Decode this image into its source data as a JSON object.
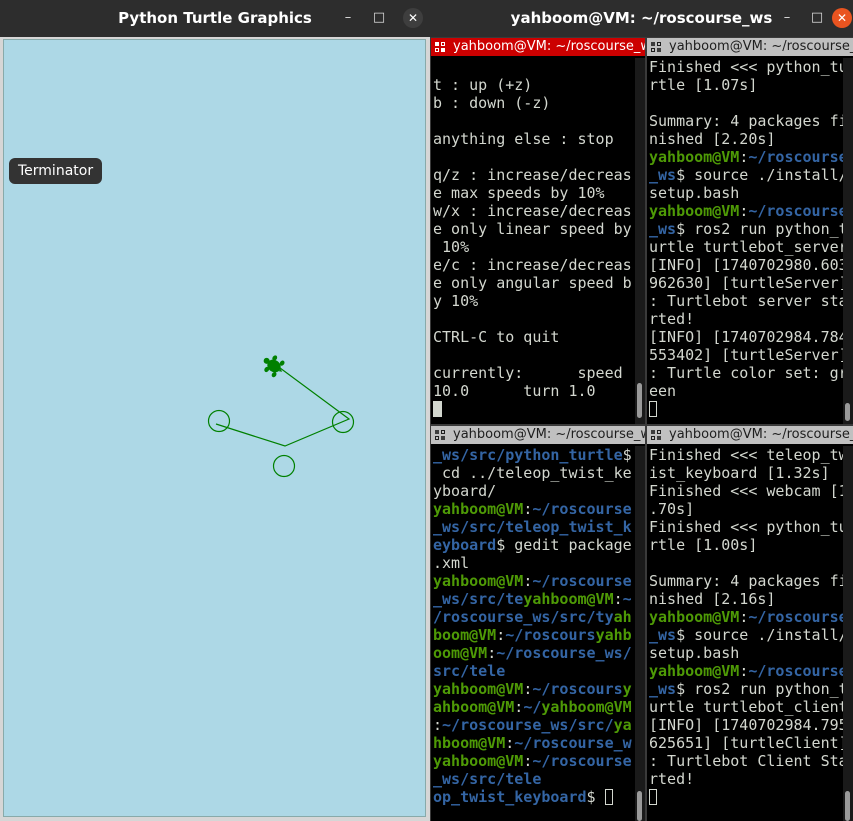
{
  "turtle_window": {
    "title": "Python Turtle Graphics",
    "minimize_icon": "minimize-icon",
    "maximize_icon": "maximize-icon",
    "close_icon": "close-icon",
    "tooltip": "Terminator",
    "canvas_bg": "#add8e6",
    "pen_color": "#008000"
  },
  "terminator": {
    "title": "yahboom@VM: ~/roscourse_ws",
    "panes": [
      {
        "name": "pane-top-left",
        "title": "yahboom@VM: ~/roscourse_ws",
        "active": true,
        "lines": [
          [
            {
              "t": ""
            }
          ],
          [
            {
              "t": "t : up (+z)"
            }
          ],
          [
            {
              "t": "b : down (-z)"
            }
          ],
          [
            {
              "t": ""
            }
          ],
          [
            {
              "t": "anything else : stop"
            }
          ],
          [
            {
              "t": ""
            }
          ],
          [
            {
              "t": "q/z : increase/decreas"
            }
          ],
          [
            {
              "t": "e max speeds by 10%"
            }
          ],
          [
            {
              "t": "w/x : increase/decreas"
            }
          ],
          [
            {
              "t": "e only linear speed by"
            }
          ],
          [
            {
              "t": " 10%"
            }
          ],
          [
            {
              "t": "e/c : increase/decreas"
            }
          ],
          [
            {
              "t": "e only angular speed b"
            }
          ],
          [
            {
              "t": "y 10%"
            }
          ],
          [
            {
              "t": ""
            }
          ],
          [
            {
              "t": "CTRL-C to quit"
            }
          ],
          [
            {
              "t": ""
            }
          ],
          [
            {
              "t": "currently:      speed "
            }
          ],
          [
            {
              "t": "10.0      turn 1.0"
            }
          ]
        ],
        "cursor": "fill"
      },
      {
        "name": "pane-top-right",
        "title": "yahboom@VM: ~/roscourse_ws",
        "active": false,
        "lines": [
          [
            {
              "t": "Finished <<< python_tu"
            }
          ],
          [
            {
              "t": "rtle [1.07s]"
            }
          ],
          [
            {
              "t": ""
            }
          ],
          [
            {
              "t": "Summary: 4 packages fi"
            }
          ],
          [
            {
              "t": "nished [2.20s]"
            }
          ],
          [
            {
              "t": "yahboom@VM",
              "c": "g"
            },
            {
              "t": ":",
              "c": ""
            },
            {
              "t": "~/roscourse",
              "c": "b"
            }
          ],
          [
            {
              "t": "_ws",
              "c": "b"
            },
            {
              "t": "$ source ./install/"
            }
          ],
          [
            {
              "t": "setup.bash"
            }
          ],
          [
            {
              "t": "yahboom@VM",
              "c": "g"
            },
            {
              "t": ":"
            },
            {
              "t": "~/roscourse",
              "c": "b"
            }
          ],
          [
            {
              "t": "_ws",
              "c": "b"
            },
            {
              "t": "$ ros2 run python_t"
            }
          ],
          [
            {
              "t": "urtle turtlebot_server"
            }
          ],
          [
            {
              "t": "[INFO] [1740702980.603"
            }
          ],
          [
            {
              "t": "962630] [turtleServer]"
            }
          ],
          [
            {
              "t": ": Turtlebot server sta"
            }
          ],
          [
            {
              "t": "rted!"
            }
          ],
          [
            {
              "t": "[INFO] [1740702984.784"
            }
          ],
          [
            {
              "t": "553402] [turtleServer]"
            }
          ],
          [
            {
              "t": ": Turtle color set: gr"
            }
          ],
          [
            {
              "t": "een"
            }
          ]
        ],
        "cursor": "box"
      },
      {
        "name": "pane-bottom-left",
        "title": "yahboom@VM: ~/roscourse_ws",
        "active": false,
        "lines": [
          [
            {
              "t": "_ws/src/python_turtle",
              "c": "b"
            },
            {
              "t": "$"
            }
          ],
          [
            {
              "t": " cd ../teleop_twist_ke"
            }
          ],
          [
            {
              "t": "yboard/"
            }
          ],
          [
            {
              "t": "yahboom@VM",
              "c": "g"
            },
            {
              "t": ":"
            },
            {
              "t": "~/roscourse",
              "c": "b"
            }
          ],
          [
            {
              "t": "_ws/src/teleop_twist_k",
              "c": "b"
            }
          ],
          [
            {
              "t": "eyboard",
              "c": "b"
            },
            {
              "t": "$ gedit package"
            }
          ],
          [
            {
              "t": ".xml"
            }
          ],
          [
            {
              "t": "yahboom@VM",
              "c": "g"
            },
            {
              "t": ":"
            },
            {
              "t": "~/roscourse",
              "c": "b"
            }
          ],
          [
            {
              "t": "_ws/src/te",
              "c": "b"
            },
            {
              "t": "yahboom@VM",
              "c": "g"
            },
            {
              "t": ":"
            },
            {
              "t": "~",
              "c": "b"
            }
          ],
          [
            {
              "t": "/roscourse_ws/src/ty",
              "c": "b"
            },
            {
              "t": "ah",
              "c": "g"
            }
          ],
          [
            {
              "t": "boom@VM",
              "c": "g"
            },
            {
              "t": ":"
            },
            {
              "t": "~/roscours",
              "c": "b"
            },
            {
              "t": "yahb",
              "c": "g"
            }
          ],
          [
            {
              "t": "oom@VM",
              "c": "g"
            },
            {
              "t": ":"
            },
            {
              "t": "~/roscourse_ws/",
              "c": "b"
            }
          ],
          [
            {
              "t": "src/tele",
              "c": "b"
            }
          ],
          [
            {
              "t": "yahboom@VM",
              "c": "g"
            },
            {
              "t": ":"
            },
            {
              "t": "~/roscours",
              "c": "b"
            },
            {
              "t": "y",
              "c": "g"
            }
          ],
          [
            {
              "t": "ahboom@VM",
              "c": "g"
            },
            {
              "t": ":"
            },
            {
              "t": "~/",
              "c": "b"
            },
            {
              "t": "yahboom@VM",
              "c": "g"
            }
          ],
          [
            {
              "t": ":"
            },
            {
              "t": "~/roscourse_ws/src/",
              "c": "b"
            },
            {
              "t": "ya",
              "c": "g"
            }
          ],
          [
            {
              "t": "hboom@VM",
              "c": "g"
            },
            {
              "t": ":"
            },
            {
              "t": "~/roscourse_w",
              "c": "b"
            }
          ],
          [
            {
              "t": "yahboom@VM",
              "c": "g"
            },
            {
              "t": ":"
            },
            {
              "t": "~/roscourse",
              "c": "b"
            }
          ],
          [
            {
              "t": "_ws/src/tele",
              "c": "b"
            }
          ],
          [
            {
              "t": "op_twist_keyboard",
              "c": "b"
            },
            {
              "t": "$ "
            }
          ]
        ],
        "cursor": "box"
      },
      {
        "name": "pane-bottom-right",
        "title": "yahboom@VM: ~/roscourse_ws",
        "active": false,
        "lines": [
          [
            {
              "t": "Finished <<< teleop_tw"
            }
          ],
          [
            {
              "t": "ist_keyboard [1.32s]"
            }
          ],
          [
            {
              "t": "Finished <<< webcam [1"
            }
          ],
          [
            {
              "t": ".70s]"
            }
          ],
          [
            {
              "t": "Finished <<< python_tu"
            }
          ],
          [
            {
              "t": "rtle [1.00s]"
            }
          ],
          [
            {
              "t": ""
            }
          ],
          [
            {
              "t": "Summary: 4 packages fi"
            }
          ],
          [
            {
              "t": "nished [2.16s]"
            }
          ],
          [
            {
              "t": "yahboom@VM",
              "c": "g"
            },
            {
              "t": ":"
            },
            {
              "t": "~/roscourse",
              "c": "b"
            }
          ],
          [
            {
              "t": "_ws",
              "c": "b"
            },
            {
              "t": "$ source ./install/"
            }
          ],
          [
            {
              "t": "setup.bash"
            }
          ],
          [
            {
              "t": "yahboom@VM",
              "c": "g"
            },
            {
              "t": ":"
            },
            {
              "t": "~/roscourse",
              "c": "b"
            }
          ],
          [
            {
              "t": "_ws",
              "c": "b"
            },
            {
              "t": "$ ros2 run python_t"
            }
          ],
          [
            {
              "t": "urtle turtlebot_client"
            }
          ],
          [
            {
              "t": "[INFO] [1740702984.795"
            }
          ],
          [
            {
              "t": "625651] [turtleClient]"
            }
          ],
          [
            {
              "t": ": Turtlebot Client Sta"
            }
          ],
          [
            {
              "t": "rted!"
            }
          ]
        ],
        "cursor": "box"
      }
    ]
  }
}
